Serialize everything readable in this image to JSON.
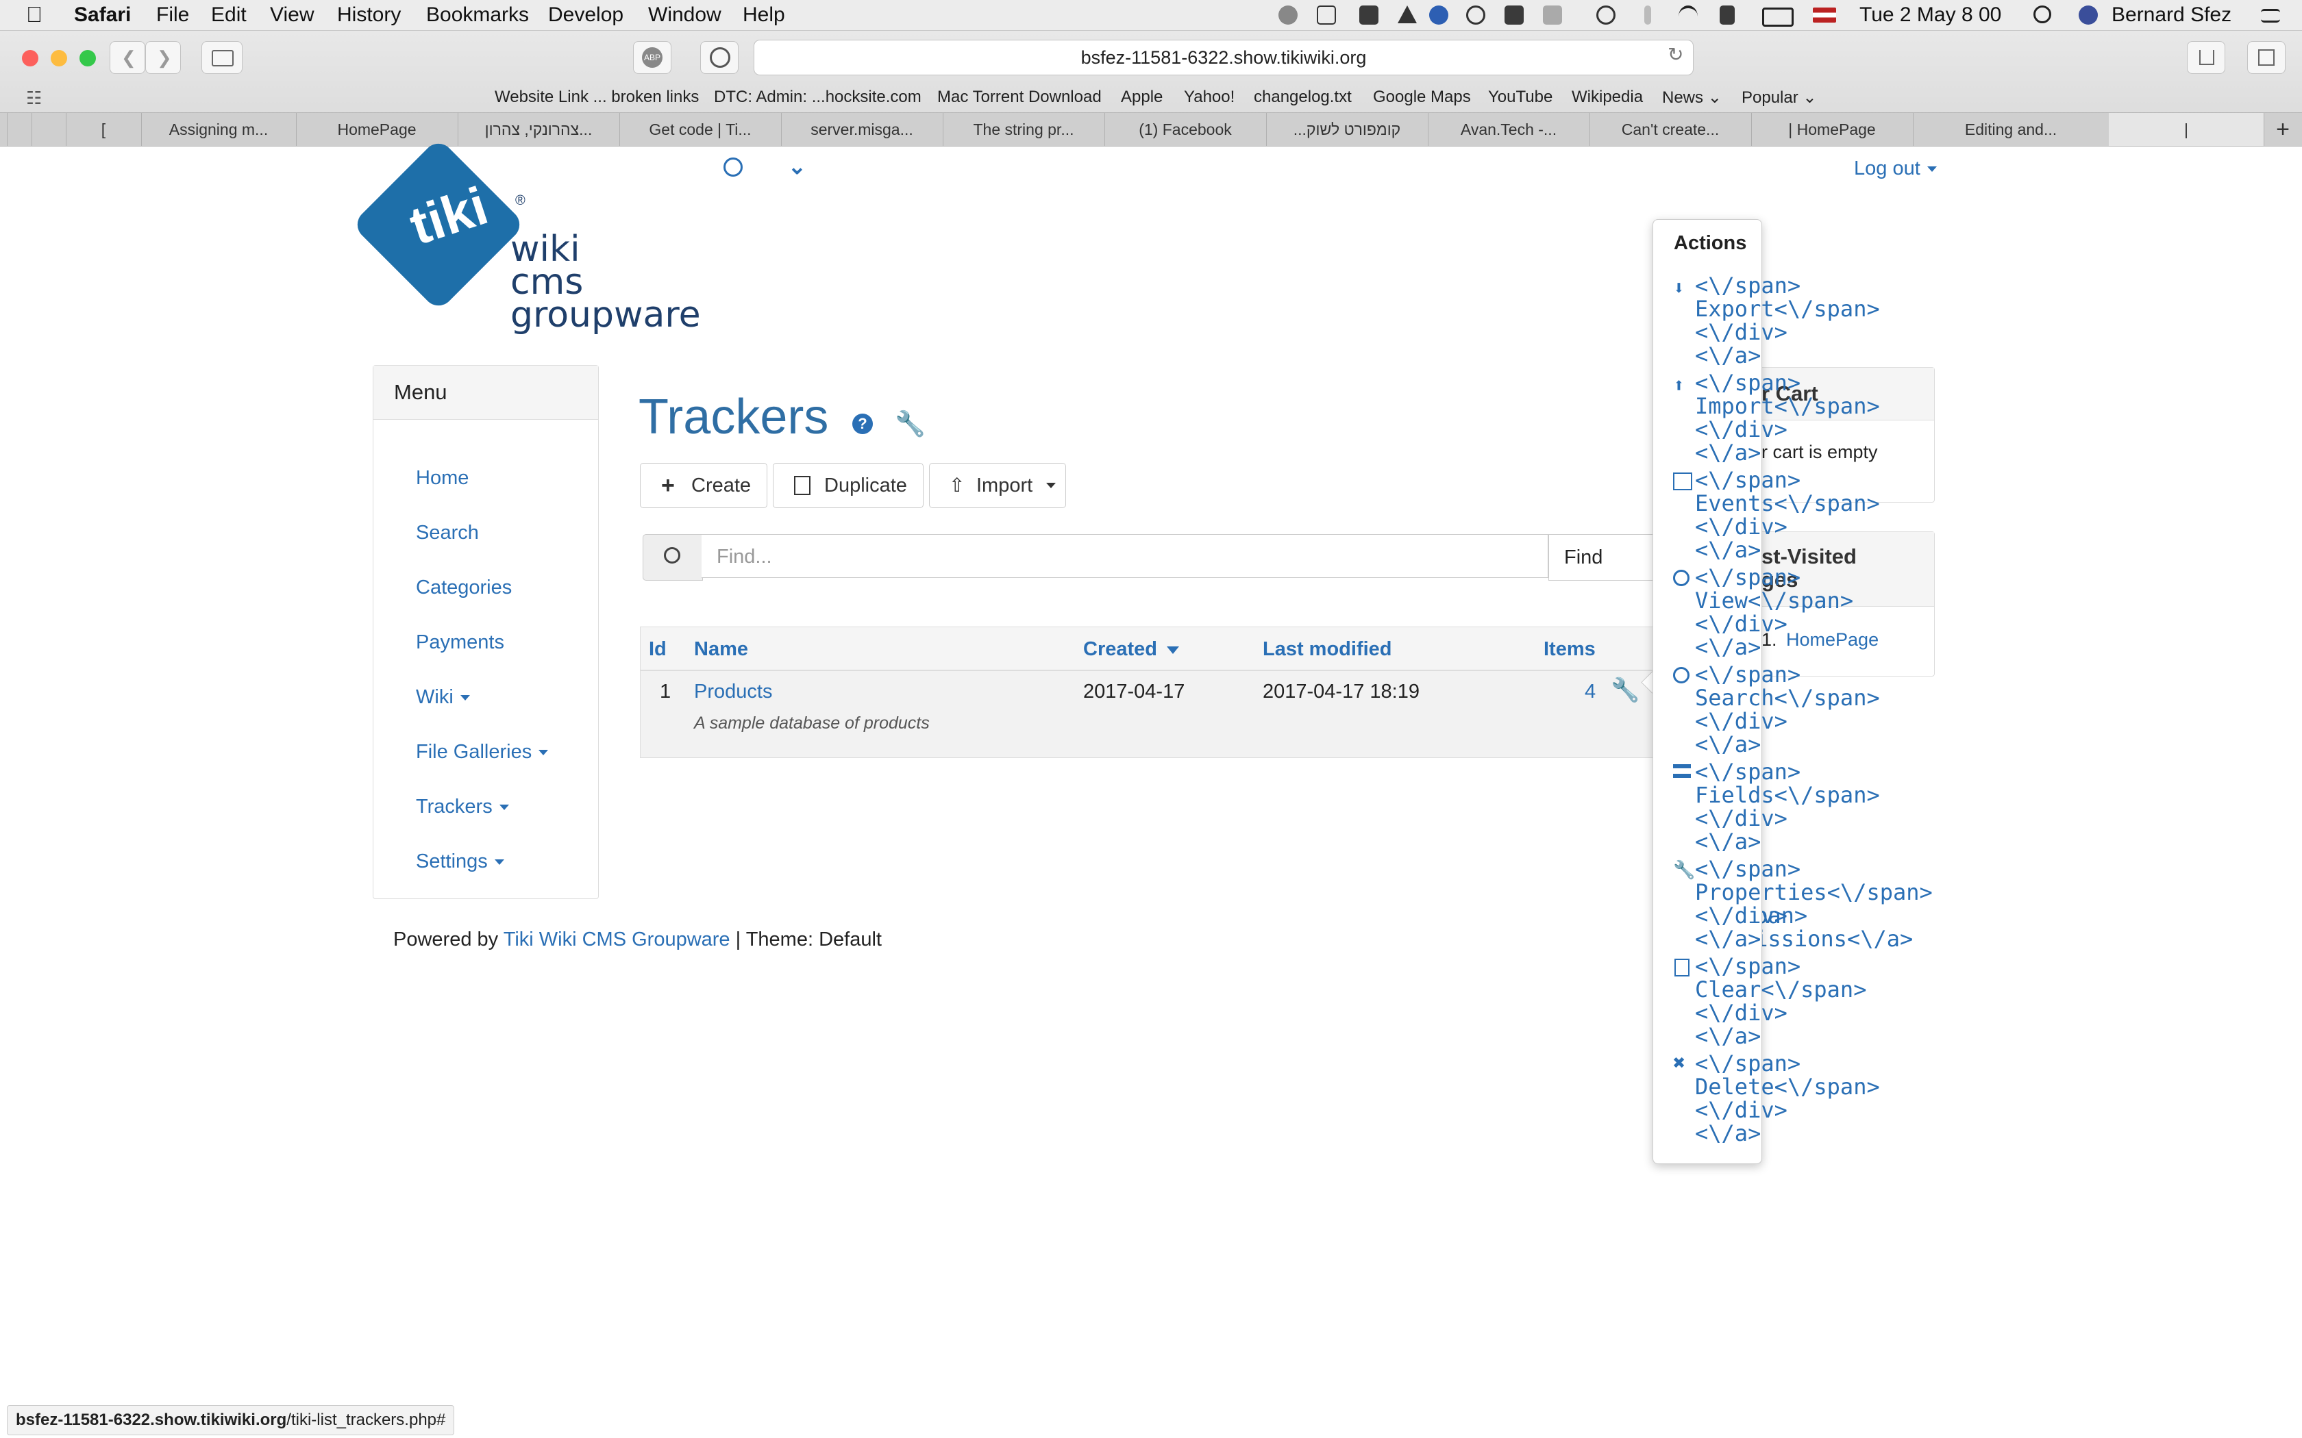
{
  "menubar": {
    "app": "Safari",
    "items": [
      "File",
      "Edit",
      "View",
      "History",
      "Bookmarks",
      "Develop",
      "Window",
      "Help"
    ],
    "clock": "Tue 2 May  8 00",
    "user": "Bernard Sfez"
  },
  "browser": {
    "url": "bsfez-11581-6322.show.tikiwiki.org",
    "bookmarks": [
      "Website Link ... broken links",
      "DTC: Admin: ...hocksite.com",
      "Mac Torrent Download",
      "Apple",
      "Yahoo!",
      "changelog.txt",
      "Google Maps",
      "YouTube",
      "Wikipedia",
      "News",
      "Popular"
    ],
    "tabs": [
      "[",
      "Assigning m...",
      "HomePage",
      "צהרונקי, צהרון...",
      "Get code | Ti...",
      "server.misga...",
      "The string pr...",
      "(1) Facebook",
      "...קומפורט לשוק",
      "Avan.Tech -...",
      "Can't create...",
      "| HomePage",
      "Editing and...",
      "|"
    ]
  },
  "header": {
    "logout": "Log out",
    "logo_words": [
      "wiki",
      "cms",
      "groupware"
    ],
    "logo_tiki": "tiki"
  },
  "menu": {
    "title": "Menu",
    "items": [
      "Home",
      "Search",
      "Categories",
      "Payments",
      "Wiki",
      "File Galleries",
      "Trackers",
      "Settings"
    ]
  },
  "main": {
    "title": "Trackers",
    "buttons": {
      "create": "Create",
      "duplicate": "Duplicate",
      "import": "Import"
    },
    "search": {
      "placeholder": "Find...",
      "find": "Find"
    },
    "table": {
      "headers": {
        "id": "Id",
        "name": "Name",
        "created": "Created",
        "modified": "Last modified",
        "items": "Items"
      },
      "rows": [
        {
          "id": "1",
          "name": "Products",
          "description": "A sample database of products",
          "created": "2017-04-17",
          "modified": "2017-04-17 18:19",
          "items": "4"
        }
      ]
    }
  },
  "footer": {
    "powered": "Powered by",
    "link": "Tiki Wiki CMS Groupware",
    "theme": "| Theme: Default"
  },
  "sidebar_panels": {
    "cart_title": "r Cart",
    "cart_text": "r cart is empty",
    "visited_title": "st-Visited",
    "visited_title2": "ges",
    "visited_num": "1.",
    "visited_item": "HomePage",
    "perm_fragment": "Permissions<\\/a>",
    "perm_icon_frag": "<\\/span>"
  },
  "popover": {
    "title": "Actions",
    "items": [
      "<\\/span>\nExport<\\/span>\n<\\/div>\n<\\/a>",
      "<\\/span>\nImport<\\/span>\n<\\/div>\n<\\/a>",
      "<\\/span>\nEvents<\\/span>\n<\\/div>\n<\\/a>",
      "<\\/span>\nView<\\/span>\n<\\/div>\n<\\/a>",
      "<\\/span>\nSearch<\\/span>\n<\\/div>\n<\\/a>",
      "<\\/span>\nFields<\\/span>\n<\\/div>\n<\\/a>",
      "<\\/span>\nProperties<\\/span>\n<\\/div>\n<\\/a>",
      "<\\/span>\nClear<\\/span>\n<\\/div>\n<\\/a>",
      "<\\/span>\nDelete<\\/span>\n<\\/div>\n<\\/a>"
    ]
  },
  "status_bar": {
    "host": "bsfez-11581-6322.show.tikiwiki.org",
    "path": "/tiki-list_trackers.php#"
  }
}
